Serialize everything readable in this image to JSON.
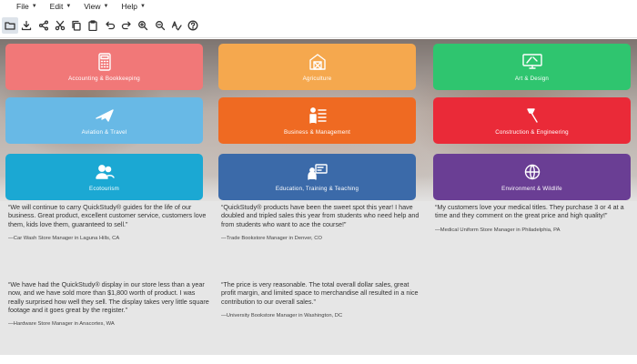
{
  "menubar": {
    "items": [
      {
        "label": "File"
      },
      {
        "label": "Edit"
      },
      {
        "label": "View"
      },
      {
        "label": "Help"
      }
    ]
  },
  "toolbar": {
    "icons": [
      "folder-icon",
      "download-icon",
      "share-icon",
      "cut-icon",
      "copy-icon",
      "paste-icon",
      "undo-icon",
      "redo-icon",
      "zoom-in-icon",
      "zoom-out-icon",
      "spellcheck-icon",
      "help-icon"
    ]
  },
  "tiles": [
    {
      "label": "Accounting & Bookkeeping",
      "icon": "calculator-icon",
      "color": "#f17878"
    },
    {
      "label": "Agriculture",
      "icon": "barn-icon",
      "color": "#f5a84e"
    },
    {
      "label": "Art & Design",
      "icon": "monitor-icon",
      "color": "#2fc56f"
    },
    {
      "label": "Aviation & Travel",
      "icon": "airplane-icon",
      "color": "#68b9e6"
    },
    {
      "label": "Business & Management",
      "icon": "business-people-icon",
      "color": "#ef6a22"
    },
    {
      "label": "Construction & Engineering",
      "icon": "hammer-icon",
      "color": "#ea2a38"
    },
    {
      "label": "Ecotourism",
      "icon": "people-icon",
      "color": "#1ba8d3"
    },
    {
      "label": "Education, Training & Teaching",
      "icon": "teacher-icon",
      "color": "#3b6aa9"
    },
    {
      "label": "Environment & Wildlife",
      "icon": "globe-icon",
      "color": "#6a3e94"
    }
  ],
  "testimonials": [
    {
      "quote": "“We will continue to carry QuickStudy® guides for the life of our business. Great product, excellent customer service, customers love them, kids love them, guaranteed to sell.”",
      "attribution": "—Car Wash Store Manager in Laguna Hills, CA"
    },
    {
      "quote": "“QuickStudy® products have been the sweet spot this year! I have doubled and tripled sales this year from students who need help and from students who want to ace the course!”",
      "attribution": "—Trade Bookstore Manager in Denver, CO"
    },
    {
      "quote": "“My customers love your medical titles. They purchase 3 or 4 at a time and they comment on the great price and high quality!”",
      "attribution": "—Medical Uniform Store Manager in Philadelphia, PA"
    },
    {
      "quote": "“We have had the QuickStudy® display in our store less than a year now, and we have sold more than $1,800 worth of product. I was really surprised how well they sell. The display takes very little square footage and it goes great by the register.”",
      "attribution": "—Hardware Store Manager in Anacortes, WA"
    },
    {
      "quote": "“The price is very reasonable. The total overall dollar sales, great profit margin, and limited space to merchandise all resulted in a nice contribution to our overall sales.”",
      "attribution": "—University Bookstore Manager in Washington, DC"
    }
  ]
}
